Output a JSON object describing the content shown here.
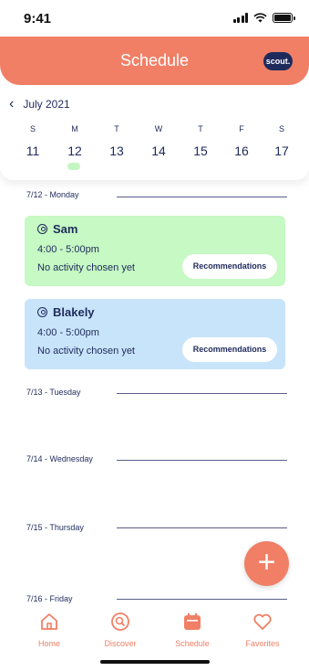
{
  "status_bar": {
    "time": "9:41"
  },
  "header": {
    "title": "Schedule",
    "logo_text": "scout."
  },
  "calendar": {
    "month": "July 2021",
    "days": [
      {
        "dow": "S",
        "num": "11"
      },
      {
        "dow": "M",
        "num": "12",
        "has_event": true
      },
      {
        "dow": "T",
        "num": "13"
      },
      {
        "dow": "W",
        "num": "14"
      },
      {
        "dow": "T",
        "num": "15"
      },
      {
        "dow": "F",
        "num": "16"
      },
      {
        "dow": "S",
        "num": "17"
      }
    ]
  },
  "schedule": {
    "sections": [
      {
        "label": "7/12 - Monday"
      },
      {
        "label": "7/13 - Tuesday"
      },
      {
        "label": "7/14 - Wednesday"
      },
      {
        "label": "7/15 - Thursday"
      },
      {
        "label": "7/16 - Friday"
      }
    ],
    "cards": [
      {
        "name": "Sam",
        "time": "4:00 - 5:00pm",
        "activity": "No activity chosen yet",
        "button": "Recommendations",
        "color": "#c6f9c3"
      },
      {
        "name": "Blakely",
        "time": "4:00 - 5:00pm",
        "activity": "No activity chosen yet",
        "button": "Recommendations",
        "color": "#c8e4fb"
      }
    ]
  },
  "fab": {
    "icon": "plus-icon",
    "label": "+"
  },
  "tabs": [
    {
      "label": "Home",
      "icon": "home-icon"
    },
    {
      "label": "Discover",
      "icon": "discover-icon"
    },
    {
      "label": "Schedule",
      "icon": "calendar-icon"
    },
    {
      "label": "Favorites",
      "icon": "heart-icon"
    }
  ],
  "colors": {
    "accent": "#f07f66",
    "text": "#1f2a5c",
    "green_card": "#c6f9c3",
    "blue_card": "#c8e4fb"
  }
}
